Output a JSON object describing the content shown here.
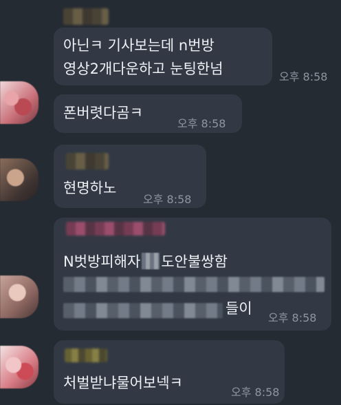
{
  "messages": [
    {
      "id": "m1",
      "lines": [
        "아닌ㅋ 기사보는데 n번방",
        "영상2개다운하고 눈팅한넘"
      ],
      "time": "오후 8:58"
    },
    {
      "id": "m2",
      "lines": [
        "폰버렷다곰ㅋ"
      ],
      "time": "오후 8:58"
    },
    {
      "id": "m3",
      "lines": [
        "현명하노"
      ],
      "time": "오후 8:58"
    },
    {
      "id": "m4",
      "line1_pre": "N벗방피해자",
      "line1_post": "도안불쌍함",
      "line3_suffix": "들이",
      "time": "오후 8:58"
    },
    {
      "id": "m5",
      "lines": [
        "처벌받냐물어보넥ㅋ"
      ],
      "time": "오후 8:58"
    }
  ]
}
